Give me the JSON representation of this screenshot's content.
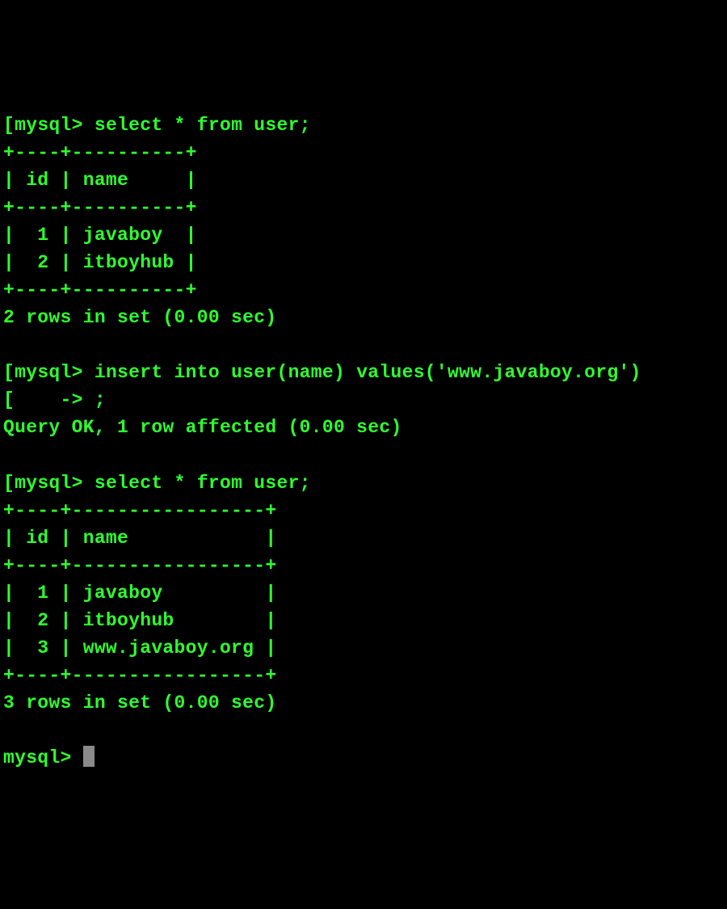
{
  "session": {
    "prompt": "mysql>",
    "continuation_prompt": "    ->",
    "bracket_open": "[",
    "bracket_close": ""
  },
  "block1": {
    "command": "select * from user;",
    "border_top": "+----+----------+",
    "header": "| id | name     |",
    "border_mid": "+----+----------+",
    "row1": "|  1 | javaboy  |",
    "row2": "|  2 | itboyhub |",
    "border_bot": "+----+----------+",
    "summary": "2 rows in set (0.00 sec)"
  },
  "block2": {
    "command": "insert into user(name) values('www.javaboy.org')",
    "continuation": ";",
    "result": "Query OK, 1 row affected (0.00 sec)"
  },
  "block3": {
    "command": "select * from user;",
    "border_top": "+----+-----------------+",
    "header": "| id | name            |",
    "border_mid": "+----+-----------------+",
    "row1": "|  1 | javaboy         |",
    "row2": "|  2 | itboyhub        |",
    "row3": "|  3 | www.javaboy.org |",
    "border_bot": "+----+-----------------+",
    "summary": "3 rows in set (0.00 sec)"
  },
  "chart_data": {
    "type": "table",
    "title": "MySQL CLI session",
    "queries": [
      {
        "sql": "select * from user;",
        "columns": [
          "id",
          "name"
        ],
        "rows": [
          {
            "id": 1,
            "name": "javaboy"
          },
          {
            "id": 2,
            "name": "itboyhub"
          }
        ],
        "summary": "2 rows in set (0.00 sec)"
      },
      {
        "sql": "insert into user(name) values('www.javaboy.org');",
        "result": "Query OK, 1 row affected (0.00 sec)"
      },
      {
        "sql": "select * from user;",
        "columns": [
          "id",
          "name"
        ],
        "rows": [
          {
            "id": 1,
            "name": "javaboy"
          },
          {
            "id": 2,
            "name": "itboyhub"
          },
          {
            "id": 3,
            "name": "www.javaboy.org"
          }
        ],
        "summary": "3 rows in set (0.00 sec)"
      }
    ]
  }
}
